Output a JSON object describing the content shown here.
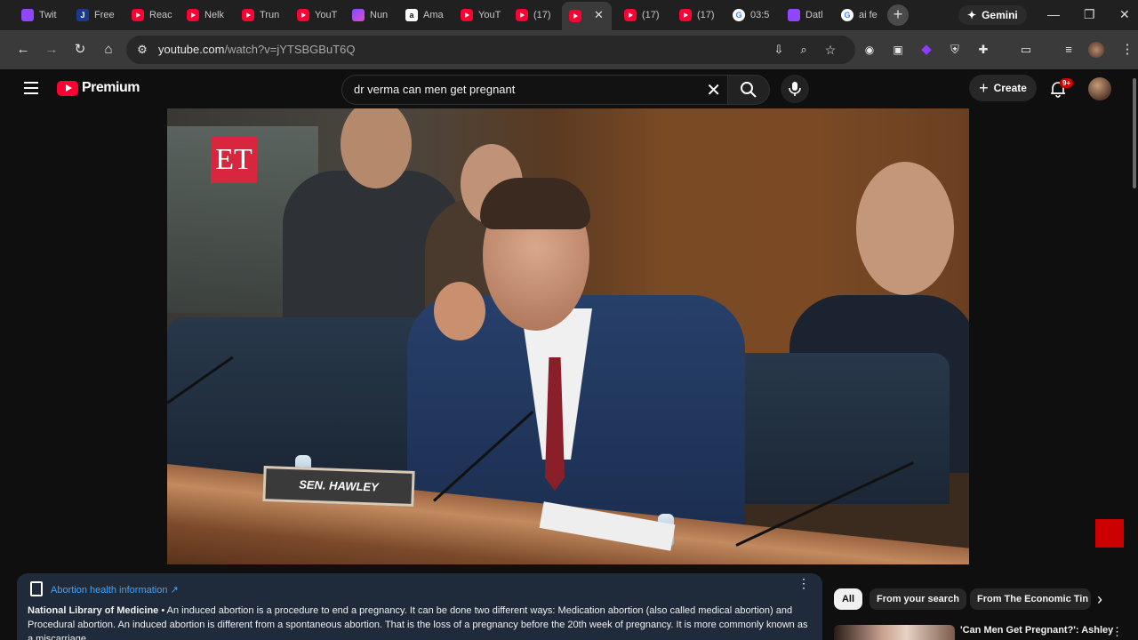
{
  "browser": {
    "tabs": [
      {
        "label": "Twit",
        "icon": "twitch-icon"
      },
      {
        "label": "Free",
        "icon": "j-icon"
      },
      {
        "label": "Reac",
        "icon": "youtube-icon"
      },
      {
        "label": "Nelk",
        "icon": "youtube-icon"
      },
      {
        "label": "Trun",
        "icon": "youtube-icon"
      },
      {
        "label": "YouT",
        "icon": "youtube-icon"
      },
      {
        "label": "Nun",
        "icon": "app-icon"
      },
      {
        "label": "Ama",
        "icon": "amazon-icon"
      },
      {
        "label": "YouT",
        "icon": "youtube-icon"
      },
      {
        "label": "(17)",
        "icon": "youtube-icon"
      },
      {
        "label": "",
        "icon": "youtube-icon"
      },
      {
        "label": "(17)",
        "icon": "youtube-icon"
      },
      {
        "label": "(17)",
        "icon": "youtube-icon"
      },
      {
        "label": "03:5",
        "icon": "google-icon"
      },
      {
        "label": "Datl",
        "icon": "twitch-icon"
      },
      {
        "label": "ai fe",
        "icon": "google-icon"
      }
    ],
    "gemini_label": "Gemini",
    "url_host": "youtube.com",
    "url_path": "/watch?v=jYTSBGBuT6Q"
  },
  "youtube": {
    "logo_text": "Premium",
    "search_value": "dr verma can men get pregnant",
    "create_label": "Create",
    "notification_badge": "9+"
  },
  "video": {
    "channel_logo": "ET",
    "nameplate": "SEN. HAWLEY"
  },
  "info_panel": {
    "title": "Abortion health information ↗",
    "source": "National Library of Medicine",
    "text": " • An induced abortion is a procedure to end a pregnancy. It can be done two different ways: Medication abortion (also called medical abortion) and Procedural abortion. An induced abortion is different from a spontaneous abortion. That is the loss of a pregnancy before the 20th week of pregnancy. It is more commonly known as a miscarriage."
  },
  "chips": [
    "All",
    "From your search",
    "From The Economic Tin"
  ],
  "recommendation": {
    "title": "'Can Men Get Pregnant?': Ashley"
  }
}
